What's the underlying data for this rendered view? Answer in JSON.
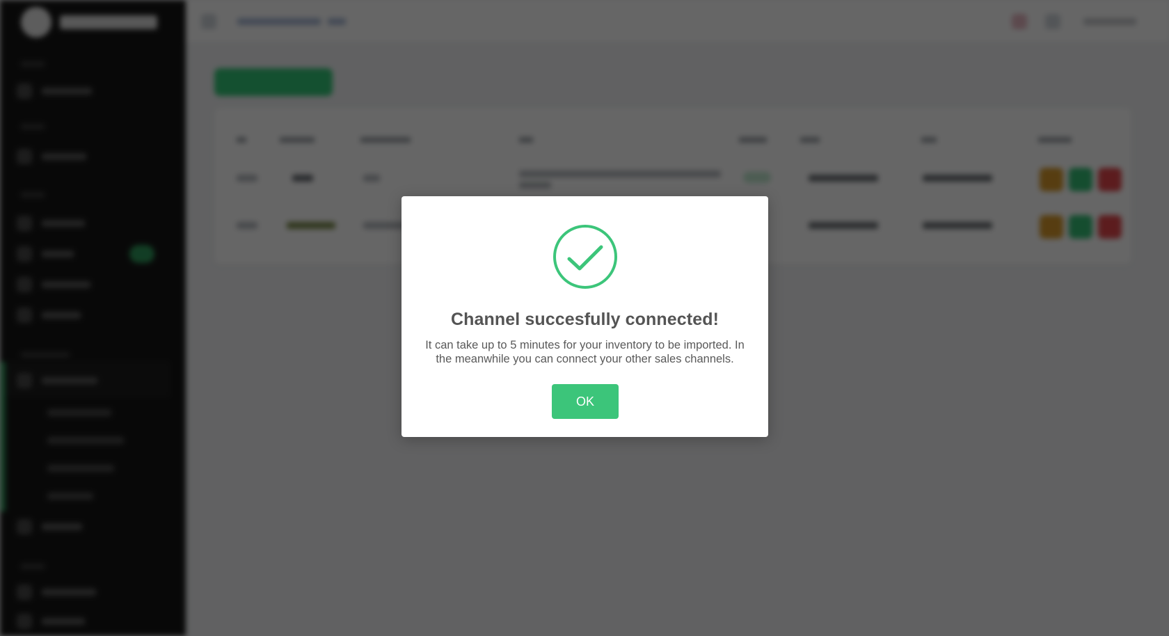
{
  "modal": {
    "title": "Channel succesfully connected!",
    "text": "It can take up to 5 minutes for your inventory to be imported. In the meanwhile you can connect your other sales channels.",
    "ok_label": "OK",
    "icon": "checkmark-circle-icon",
    "accent_color": "#3cc57a"
  },
  "background": {
    "note_blurred": true,
    "sidebar_color": "#161616",
    "accent_color": "#2f9a5c",
    "action_colors": [
      "#d99a2b",
      "#35c077",
      "#e5484d"
    ]
  }
}
